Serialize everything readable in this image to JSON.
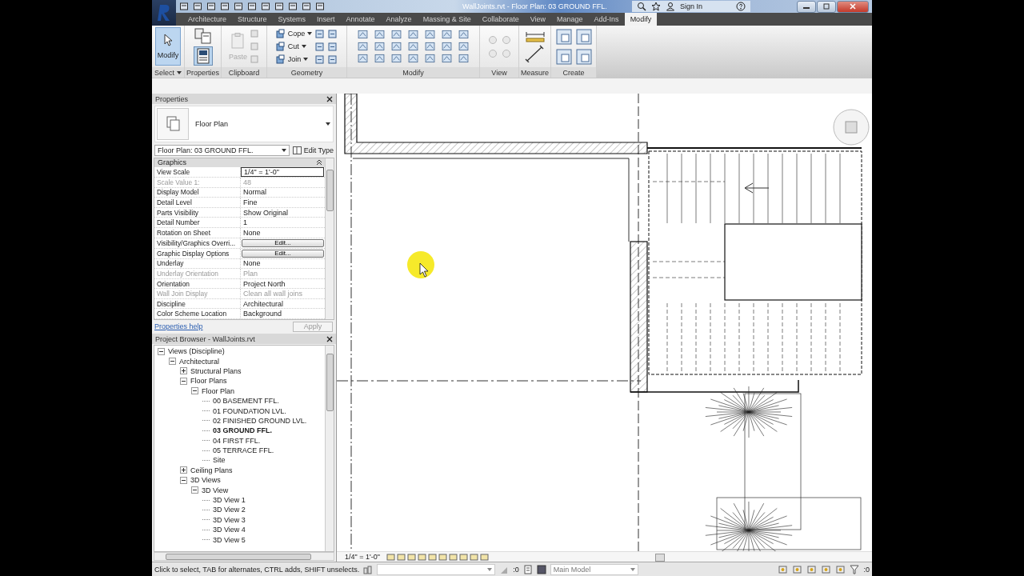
{
  "title_bar": {
    "document_title": "WallJoints.rvt - Floor Plan: 03 GROUND FFL.",
    "sign_in": "Sign In"
  },
  "ribbon_tabs": [
    {
      "label": "Architecture",
      "selected": false
    },
    {
      "label": "Structure",
      "selected": false
    },
    {
      "label": "Systems",
      "selected": false
    },
    {
      "label": "Insert",
      "selected": false
    },
    {
      "label": "Annotate",
      "selected": false
    },
    {
      "label": "Analyze",
      "selected": false
    },
    {
      "label": "Massing & Site",
      "selected": false
    },
    {
      "label": "Collaborate",
      "selected": false
    },
    {
      "label": "View",
      "selected": false
    },
    {
      "label": "Manage",
      "selected": false
    },
    {
      "label": "Add-Ins",
      "selected": false
    },
    {
      "label": "Modify",
      "selected": true
    }
  ],
  "ribbon_panels": [
    {
      "label": "Select",
      "menu": true
    },
    {
      "label": "Properties",
      "menu": false
    },
    {
      "label": "Clipboard",
      "menu": false
    },
    {
      "label": "Geometry",
      "menu": false
    },
    {
      "label": "Modify",
      "menu": false
    },
    {
      "label": "View",
      "menu": false
    },
    {
      "label": "Measure",
      "menu": false
    },
    {
      "label": "Create",
      "menu": false
    }
  ],
  "modify_tool": {
    "label": "Modify",
    "selected": true
  },
  "paste_tool": {
    "label": "Paste",
    "disabled": true
  },
  "geometry_tools": [
    {
      "label": "Cope"
    },
    {
      "label": "Cut"
    },
    {
      "label": "Join"
    }
  ],
  "properties": {
    "title": "Properties",
    "type_name": "Floor Plan",
    "instance": "Floor Plan: 03 GROUND FFL.",
    "edit_type": "Edit Type",
    "group": "Graphics",
    "rows": [
      {
        "name": "View Scale",
        "value": "1/4\" = 1'-0\"",
        "kind": "field",
        "disabled": false
      },
      {
        "name": "Scale Value    1:",
        "value": "48",
        "kind": "text",
        "disabled": true
      },
      {
        "name": "Display Model",
        "value": "Normal",
        "kind": "text",
        "disabled": false
      },
      {
        "name": "Detail Level",
        "value": "Fine",
        "kind": "text",
        "disabled": false
      },
      {
        "name": "Parts Visibility",
        "value": "Show Original",
        "kind": "text",
        "disabled": false
      },
      {
        "name": "Detail Number",
        "value": "1",
        "kind": "text",
        "disabled": false
      },
      {
        "name": "Rotation on Sheet",
        "value": "None",
        "kind": "text",
        "disabled": false
      },
      {
        "name": "Visibility/Graphics Overri...",
        "value": "Edit...",
        "kind": "button",
        "disabled": false
      },
      {
        "name": "Graphic Display Options",
        "value": "Edit...",
        "kind": "button",
        "disabled": false
      },
      {
        "name": "Underlay",
        "value": "None",
        "kind": "text",
        "disabled": false
      },
      {
        "name": "Underlay Orientation",
        "value": "Plan",
        "kind": "text",
        "disabled": true
      },
      {
        "name": "Orientation",
        "value": "Project North",
        "kind": "text",
        "disabled": false
      },
      {
        "name": "Wall Join Display",
        "value": "Clean all wall joins",
        "kind": "text",
        "disabled": true
      },
      {
        "name": "Discipline",
        "value": "Architectural",
        "kind": "text",
        "disabled": false
      },
      {
        "name": "Color Scheme Location",
        "value": "Background",
        "kind": "text",
        "disabled": false
      }
    ],
    "help": "Properties help",
    "apply": "Apply"
  },
  "project_browser": {
    "title": "Project Browser - WallJoints.rvt",
    "tree": [
      {
        "label": "Views (Discipline)",
        "expanded": true,
        "selected": false,
        "children": [
          {
            "label": "Architectural",
            "expanded": true,
            "selected": false,
            "children": [
              {
                "label": "Structural Plans",
                "expanded": false,
                "selected": false
              },
              {
                "label": "Floor Plans",
                "expanded": true,
                "selected": false,
                "children": [
                  {
                    "label": "Floor Plan",
                    "expanded": true,
                    "selected": false,
                    "children": [
                      {
                        "label": "00 BASEMENT FFL.",
                        "selected": false
                      },
                      {
                        "label": "01 FOUNDATION LVL.",
                        "selected": false
                      },
                      {
                        "label": "02 FINISHED GROUND LVL.",
                        "selected": false
                      },
                      {
                        "label": "03 GROUND FFL.",
                        "selected": true
                      },
                      {
                        "label": "04 FIRST FFL.",
                        "selected": false
                      },
                      {
                        "label": "05 TERRACE FFL.",
                        "selected": false
                      },
                      {
                        "label": "Site",
                        "selected": false
                      }
                    ]
                  }
                ]
              },
              {
                "label": "Ceiling Plans",
                "expanded": false,
                "selected": false
              },
              {
                "label": "3D Views",
                "expanded": true,
                "selected": false,
                "children": [
                  {
                    "label": "3D View",
                    "expanded": true,
                    "selected": false,
                    "children": [
                      {
                        "label": "3D View 1",
                        "selected": false
                      },
                      {
                        "label": "3D View 2",
                        "selected": false
                      },
                      {
                        "label": "3D View 3",
                        "selected": false
                      },
                      {
                        "label": "3D View 4",
                        "selected": false
                      },
                      {
                        "label": "3D View 5",
                        "selected": false
                      }
                    ]
                  }
                ]
              }
            ]
          }
        ]
      }
    ]
  },
  "view_control_bar": {
    "scale": "1/4\" = 1'-0\""
  },
  "status_bar": {
    "message": "Click to select, TAB for alternates, CTRL adds, SHIFT unselects.",
    "editable_count": ":0",
    "workset": "Main Model",
    "filter_count": ":0"
  }
}
